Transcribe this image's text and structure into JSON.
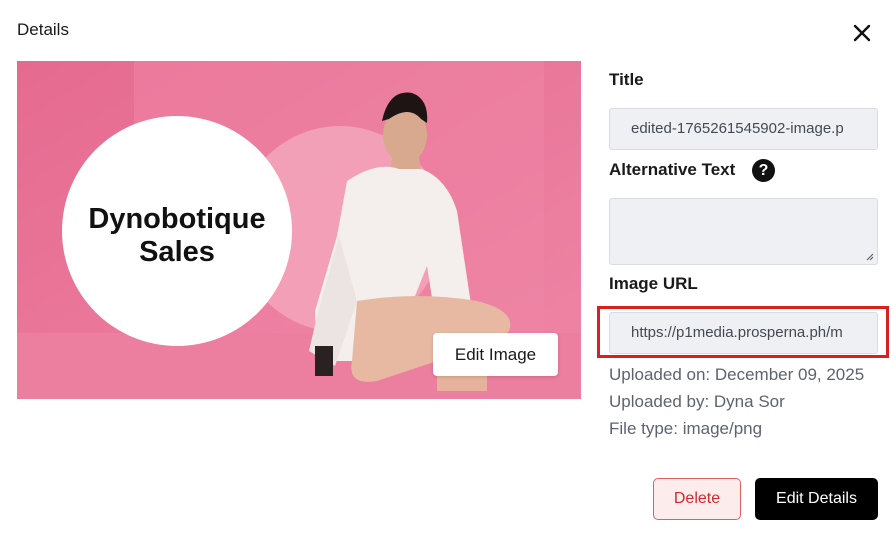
{
  "modal": {
    "title": "Details"
  },
  "preview": {
    "brand_line1": "Dynobotique",
    "brand_line2": "Sales",
    "edit_image_label": "Edit Image"
  },
  "fields": {
    "title_label": "Title",
    "title_value": "edited-1765261545902-image.p",
    "alt_text_label": "Alternative Text",
    "alt_text_value": "",
    "image_url_label": "Image URL",
    "image_url_value": "https://p1media.prosperna.ph/m"
  },
  "meta": {
    "uploaded_on": "Uploaded on: December 09, 2025",
    "uploaded_by": "Uploaded by: Dyna Sor",
    "file_type": "File type: image/png"
  },
  "actions": {
    "delete_label": "Delete",
    "edit_details_label": "Edit Details"
  },
  "icons": {
    "close": "close-icon",
    "help": "question-circle-icon"
  },
  "colors": {
    "highlight": "#d72020",
    "primary_button": "#000000",
    "danger": "#d42a2a",
    "preview_pink": "#e46f94"
  }
}
